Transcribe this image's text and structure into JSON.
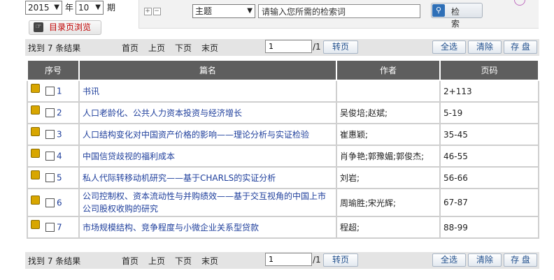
{
  "filters": {
    "year": "2015",
    "year_label": "年",
    "issue": "10",
    "issue_label": "期"
  },
  "search": {
    "expand_icons": "⊞⊟",
    "field": "主题",
    "placeholder": "请输入您所需的检索词",
    "button": "检 索"
  },
  "browse_button": "目录页浏览",
  "toolbar": {
    "found": "找到 7 条结果",
    "first": "首页",
    "prev": "上页",
    "next": "下页",
    "last": "末页",
    "page_value": "1",
    "page_total": "/1",
    "goto": "转页",
    "select_all": "全选",
    "clear": "清除",
    "save": "存 盘"
  },
  "table": {
    "headers": [
      "序号",
      "篇名",
      "作者",
      "页码"
    ],
    "rows": [
      {
        "no": "1",
        "title": "书讯",
        "author": "",
        "pages": "2+113"
      },
      {
        "no": "2",
        "title": "人口老龄化、公共人力资本投资与经济增长",
        "author": "吴俊培;赵斌;",
        "pages": "5-19"
      },
      {
        "no": "3",
        "title": "人口结构变化对中国资产价格的影响——理论分析与实证检验",
        "author": "崔惠颖;",
        "pages": "35-45"
      },
      {
        "no": "4",
        "title": "中国信贷歧视的福利成本",
        "author": "肖争艳;郭豫媚;郭俊杰;",
        "pages": "46-55"
      },
      {
        "no": "5",
        "title": "私人代际转移动机研究——基于CHARLS的实证分析",
        "author": "刘岩;",
        "pages": "56-66"
      },
      {
        "no": "6",
        "title": "公司控制权、资本流动性与并购绩效——基于交互视角的中国上市公司股权收购的研究",
        "author": "周瑜胜;宋光辉;",
        "pages": "67-87"
      },
      {
        "no": "7",
        "title": "市场规模结构、竞争程度与小微企业关系型贷款",
        "author": "程超;",
        "pages": "88-99"
      }
    ]
  }
}
